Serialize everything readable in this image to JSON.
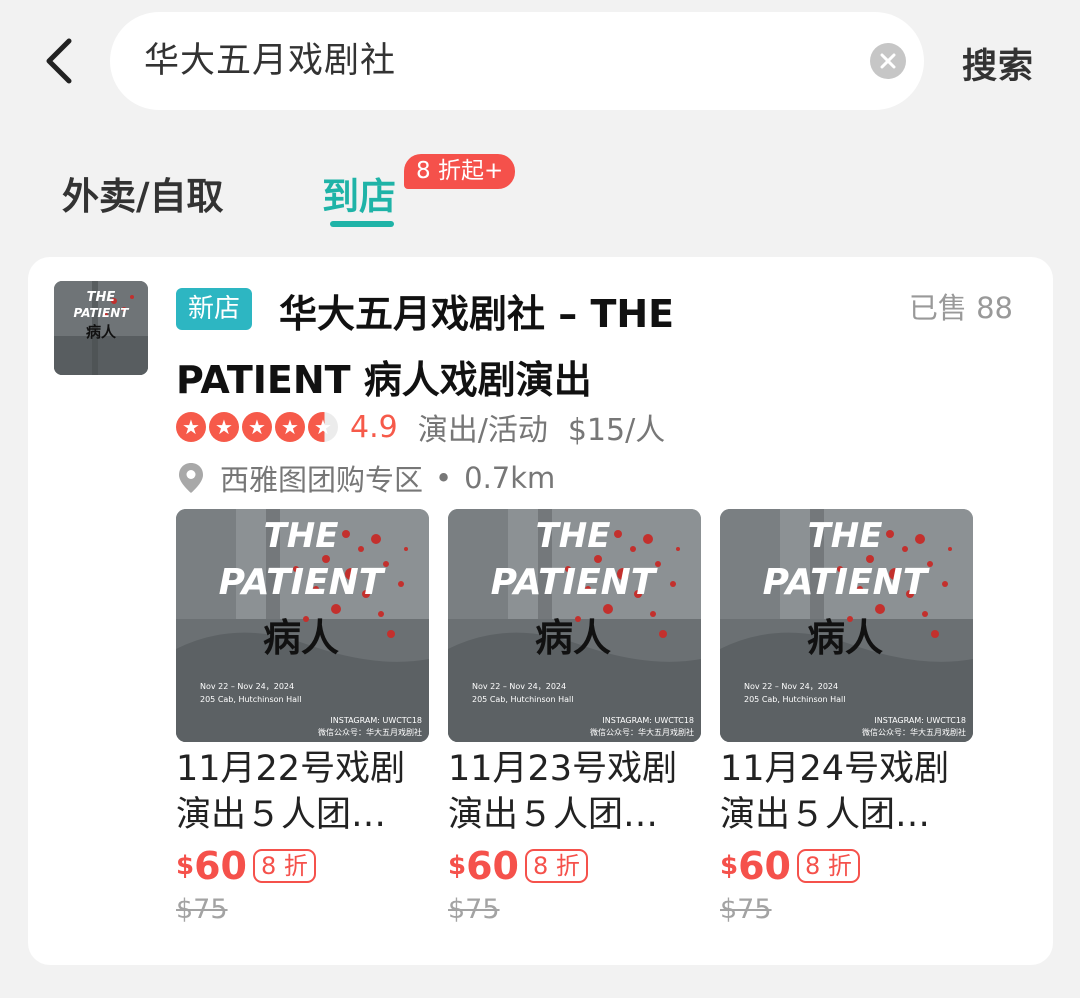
{
  "search": {
    "query": "华大五月戏剧社",
    "submit_label": "搜索"
  },
  "tabs": {
    "delivery": "外卖/自取",
    "instore": "到店",
    "promo_badge": "8 折起+"
  },
  "store": {
    "new_badge": "新店",
    "title": "华大五月戏剧社 – THE PATIENT 病人戏剧演出",
    "sold": "已售 88",
    "rating": "4.9",
    "category": "演出/活动",
    "price_per_person": "$15/人",
    "location": "西雅图团购专区",
    "distance": "0.7km",
    "thumb_lines": [
      "THE",
      "PATIENT",
      "病人"
    ]
  },
  "poster": {
    "line1": "THE",
    "line2": "PATIENT",
    "line3": "病人",
    "date": "Nov 22 – Nov 24，2024",
    "venue": "205 Cab, Hutchinson Hall",
    "instagram": "INSTAGRAM: UWCTC18",
    "wechat": "微信公众号：华大五月戏剧社"
  },
  "deals": [
    {
      "title": "11月22号戏剧",
      "title2": "演出５人团…",
      "currency": "$",
      "price": "60",
      "discount": "8 折",
      "original": "$75"
    },
    {
      "title": "11月23号戏剧",
      "title2": "演出５人团…",
      "currency": "$",
      "price": "60",
      "discount": "8 折",
      "original": "$75"
    },
    {
      "title": "11月24号戏剧",
      "title2": "演出５人团…",
      "currency": "$",
      "price": "60",
      "discount": "8 折",
      "original": "$75"
    }
  ],
  "colors": {
    "accent_teal": "#1fb3a7",
    "badge_red": "#f5514b",
    "new_badge": "#2db6c2"
  }
}
